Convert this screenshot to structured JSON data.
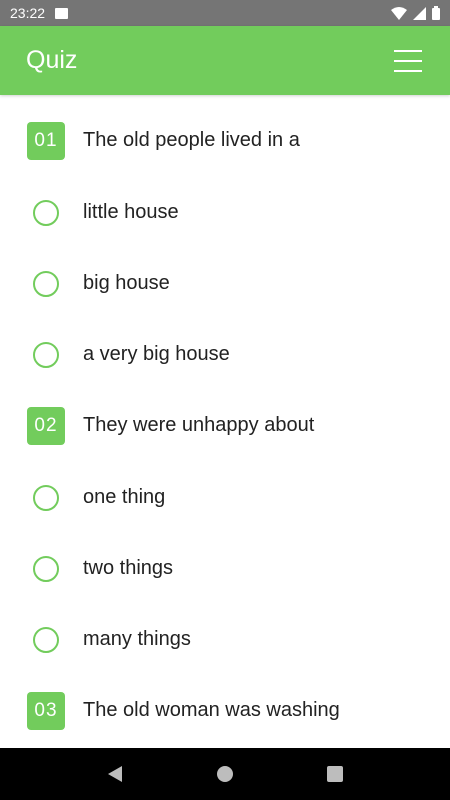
{
  "status_bar": {
    "time": "23:22"
  },
  "app_bar": {
    "title": "Quiz",
    "menu_icon": "hamburger-menu-icon"
  },
  "colors": {
    "accent": "#72cc5c",
    "status_bar": "#757575",
    "nav_bar": "#000000",
    "text": "#222222"
  },
  "questions": [
    {
      "number": "01",
      "text": "The old people lived in a",
      "options": [
        "little house",
        "big house",
        "a very big house"
      ]
    },
    {
      "number": "02",
      "text": "They were unhappy about",
      "options": [
        "one thing",
        "two things",
        "many things"
      ]
    },
    {
      "number": "03",
      "text": "The old woman was washing",
      "options": []
    }
  ]
}
